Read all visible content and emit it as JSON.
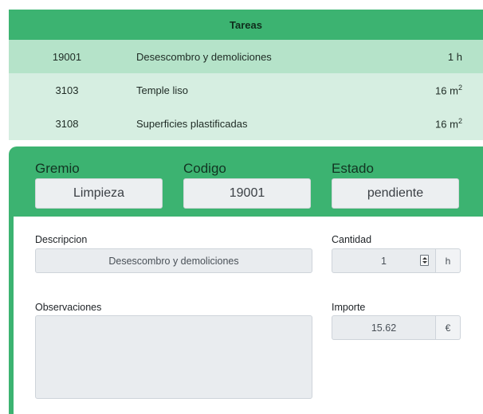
{
  "tasks": {
    "title": "Tareas",
    "rows": [
      {
        "code": "19001",
        "description": "Desescombro y demoliciones",
        "qty": "1",
        "unit": "h",
        "exp": ""
      },
      {
        "code": "3103",
        "description": "Temple liso",
        "qty": "16",
        "unit": "m",
        "exp": "2"
      },
      {
        "code": "3108",
        "description": "Superficies plastificadas",
        "qty": "16",
        "unit": "m",
        "exp": "2"
      }
    ]
  },
  "detail": {
    "gremio_label": "Gremio",
    "gremio_value": "Limpieza",
    "codigo_label": "Codigo",
    "codigo_value": "19001",
    "estado_label": "Estado",
    "estado_value": "pendiente",
    "descripcion_label": "Descripcion",
    "descripcion_value": "Desescombro y demoliciones",
    "cantidad_label": "Cantidad",
    "cantidad_value": "1",
    "cantidad_unit": "h",
    "observaciones_label": "Observaciones",
    "observaciones_value": "",
    "importe_label": "Importe",
    "importe_value": "15.62",
    "importe_unit": "€"
  },
  "colors": {
    "accent": "#3cb371",
    "row_selected": "#b5e3c9",
    "row": "#d6eee1"
  }
}
